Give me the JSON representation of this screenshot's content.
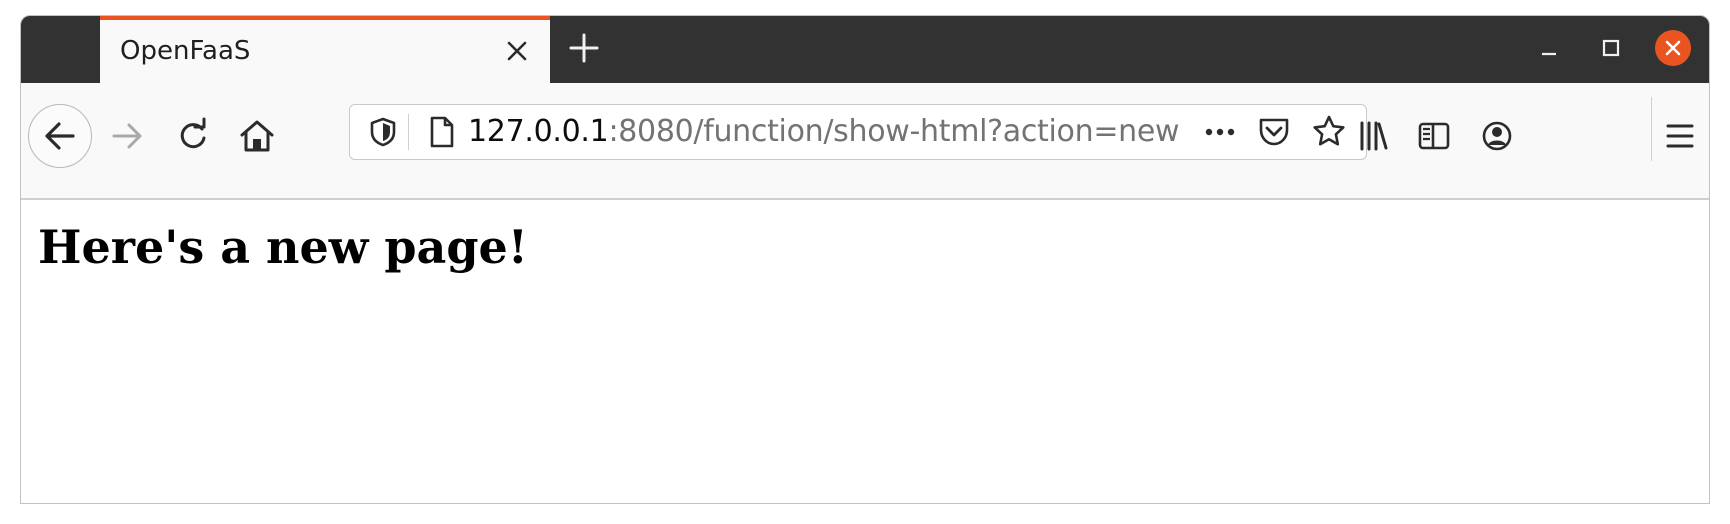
{
  "browser": {
    "tab": {
      "title": "OpenFaaS",
      "close_icon": "close-icon"
    },
    "new_tab_icon": "plus-icon",
    "window_controls": {
      "minimize": "minimize-icon",
      "maximize": "maximize-icon",
      "close": "close-icon",
      "close_color": "#e95420"
    },
    "toolbar": {
      "back": "back-arrow-icon",
      "forward": "forward-arrow-icon",
      "reload": "reload-icon",
      "home": "home-icon",
      "url": {
        "host": "127.0.0.1",
        "rest": ":8080/function/show-html?action=new"
      },
      "url_icons": [
        "shield-icon",
        "page-icon",
        "more-icon",
        "pocket-icon",
        "star-icon"
      ],
      "right_icons": [
        "library-icon",
        "sidebar-icon",
        "account-icon",
        "menu-icon"
      ]
    },
    "accent_color": "#e95420"
  },
  "page": {
    "heading": "Here's a new page!"
  }
}
